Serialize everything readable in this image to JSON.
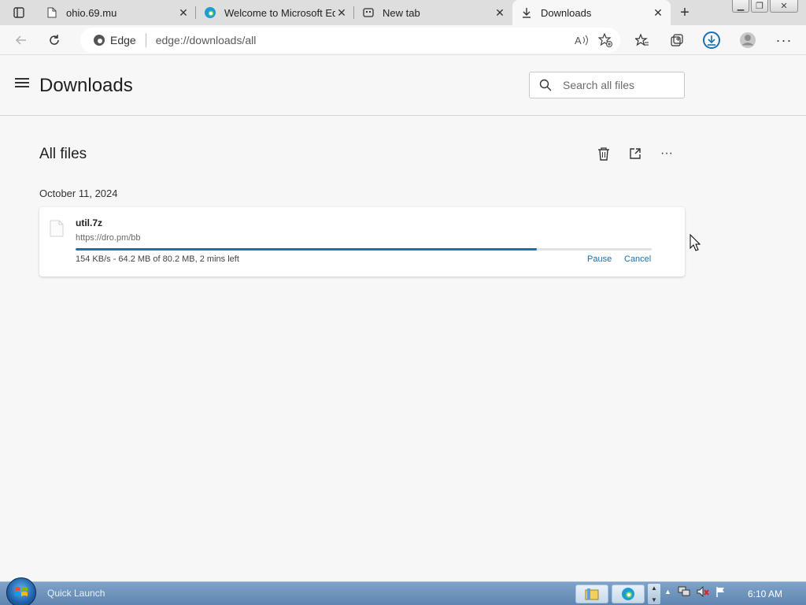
{
  "tabs": [
    {
      "title": "ohio.69.mu",
      "icon": "page-icon",
      "active": false
    },
    {
      "title": "Welcome to Microsoft Ed",
      "icon": "edge-icon",
      "active": false
    },
    {
      "title": "New tab",
      "icon": "newtab-icon",
      "active": false
    },
    {
      "title": "Downloads",
      "icon": "download-icon",
      "active": true
    }
  ],
  "address_bar": {
    "site_label": "Edge",
    "url": "edge://downloads/all"
  },
  "page": {
    "title": "Downloads",
    "search_placeholder": "Search all files",
    "section_title": "All files",
    "date_group": "October 11, 2024"
  },
  "download": {
    "file_name": "util.7z",
    "source_url": "https://dro.pm/bb",
    "status": "154 KB/s - 64.2 MB of 80.2 MB, 2 mins left",
    "progress_fraction": 0.8,
    "pause_label": "Pause",
    "cancel_label": "Cancel"
  },
  "taskbar": {
    "quick_launch": "Quick Launch",
    "clock": "6:10 AM"
  },
  "colors": {
    "accent": "#1a70b0",
    "page_bg": "#f7f7f7",
    "tabstrip_bg": "#dedede"
  }
}
